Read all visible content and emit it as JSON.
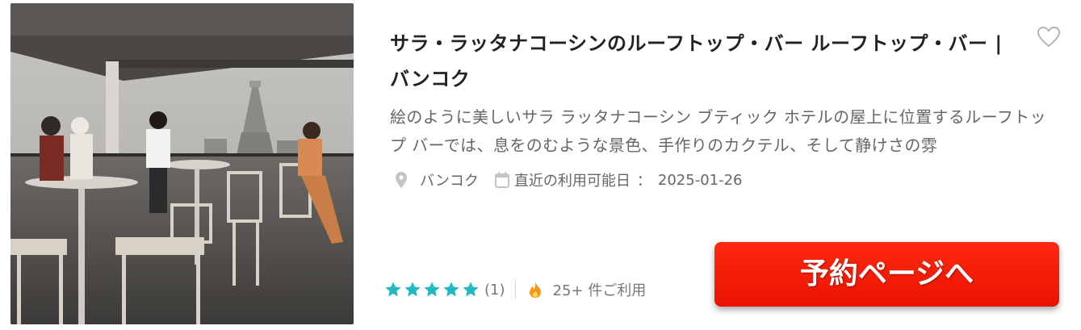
{
  "card": {
    "title": "サラ・ラッタナコーシンのルーフトップ・バー ルーフトップ・バー |バンコク",
    "description": "絵のように美しいサラ ラッタナコーシン ブティック ホテルの屋上に位置するルーフトップ バーでは、息をのむような景色、手作りのカクテル、そして静けさの雰",
    "location": "バンコク",
    "availability_label": "直近の利用可能日",
    "availability_separator": "：",
    "availability_date": "2025-01-26",
    "rating_stars": 5,
    "review_count": "(1)",
    "usage_text": "25+ 件ご利用",
    "book_button_label": "予約ページへ"
  },
  "colors": {
    "star": "#27b8c4",
    "flame": "#f39a1e",
    "button": "#f01a05",
    "title": "#222222",
    "text_muted": "#666666"
  },
  "icons": {
    "favorite": "heart-outline-icon",
    "location": "map-pin-icon",
    "date": "calendar-icon",
    "rating": "star-icon",
    "usage": "flame-icon"
  }
}
